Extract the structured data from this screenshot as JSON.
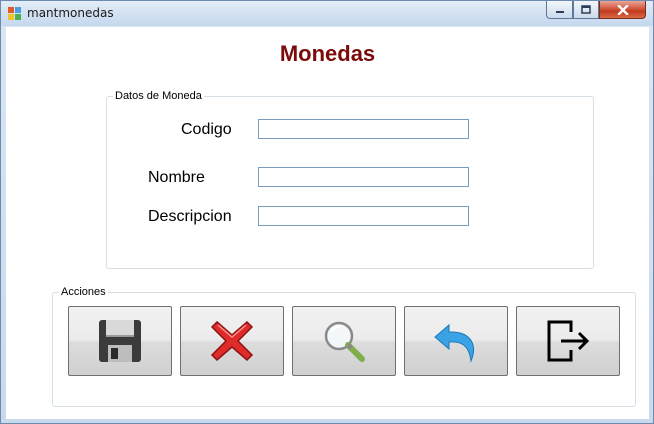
{
  "window": {
    "title": "mantmonedas",
    "min_icon": "minimize-icon",
    "max_icon": "maximize-icon",
    "close_icon": "close-icon"
  },
  "form": {
    "title": "Monedas",
    "title_color": "#7b0b0b"
  },
  "datos": {
    "legend": "Datos de Moneda",
    "codigo_label": "Codigo",
    "codigo_value": "",
    "nombre_label": "Nombre",
    "nombre_value": "",
    "descripcion_label": "Descripcion",
    "descripcion_value": ""
  },
  "acciones": {
    "legend": "Acciones",
    "buttons": [
      {
        "name": "save-button",
        "icon": "floppy-disk-icon"
      },
      {
        "name": "delete-button",
        "icon": "red-x-icon"
      },
      {
        "name": "search-button",
        "icon": "magnifier-icon"
      },
      {
        "name": "undo-button",
        "icon": "undo-arrow-icon"
      },
      {
        "name": "exit-button",
        "icon": "exit-door-icon"
      }
    ]
  }
}
